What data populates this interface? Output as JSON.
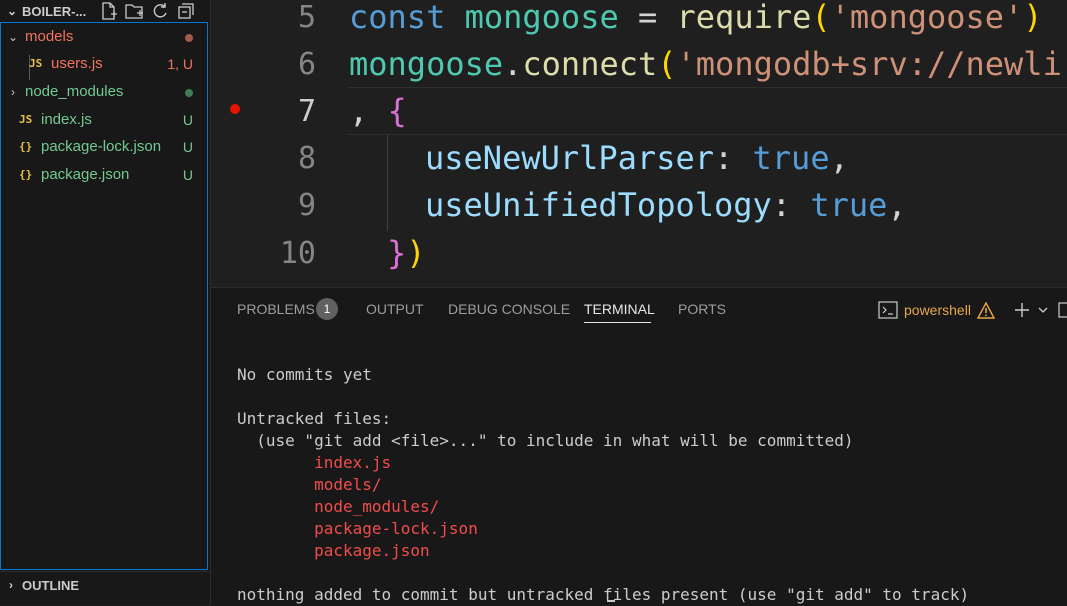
{
  "sidebar": {
    "title": "BOILER-...",
    "items": [
      {
        "label": "models",
        "status": "",
        "color": "#f2735f",
        "dot": "#a35a4c"
      },
      {
        "label": "users.js",
        "status": "1, U",
        "color": "#f2735f",
        "icon": "JS"
      },
      {
        "label": "node_modules",
        "status": "",
        "color": "#73c991",
        "dot": "#3e7d56"
      },
      {
        "label": "index.js",
        "status": "U",
        "color": "#73c991",
        "icon": "JS"
      },
      {
        "label": "package-lock.json",
        "status": "U",
        "color": "#73c991",
        "icon": "{}"
      },
      {
        "label": "package.json",
        "status": "U",
        "color": "#73c991",
        "icon": "{}"
      }
    ],
    "outline_label": "OUTLINE"
  },
  "editor": {
    "line_numbers": [
      "5",
      "6",
      "7",
      "8",
      "9",
      "10"
    ],
    "lines": [
      [
        [
          "const",
          "kw"
        ],
        [
          " ",
          "punc"
        ],
        [
          "mongoose",
          "var"
        ],
        [
          " = ",
          "punc"
        ],
        [
          "require",
          "fn"
        ],
        [
          "(",
          "br1"
        ],
        [
          "'mongoose'",
          "str"
        ],
        [
          ")",
          "br1"
        ]
      ],
      [
        [
          "mongoose",
          "var"
        ],
        [
          ".",
          "punc"
        ],
        [
          "connect",
          "fn"
        ],
        [
          "(",
          "br1"
        ],
        [
          "'mongodb+srv://newli",
          "str"
        ]
      ],
      [
        [
          ", ",
          "punc"
        ],
        [
          "{",
          "br2"
        ]
      ],
      [
        [
          "  useNewUrlParser",
          "prop"
        ],
        [
          ": ",
          "punc"
        ],
        [
          "true",
          "kw"
        ],
        [
          ",",
          "punc"
        ]
      ],
      [
        [
          "  useUnifiedTopology",
          "prop"
        ],
        [
          ": ",
          "punc"
        ],
        [
          "true",
          "kw"
        ],
        [
          ",",
          "punc"
        ]
      ],
      [
        [
          "}",
          "br2"
        ],
        [
          ")",
          "br1"
        ]
      ]
    ]
  },
  "panel": {
    "tabs": [
      "PROBLEMS",
      "OUTPUT",
      "DEBUG CONSOLE",
      "TERMINAL",
      "PORTS"
    ],
    "problems_count": "1",
    "active_tab": "TERMINAL",
    "shell_name": "powershell"
  },
  "terminal": {
    "lines": [
      {
        "text": "No commits yet",
        "color": "normal"
      },
      {
        "text": "",
        "color": "normal"
      },
      {
        "text": "Untracked files:",
        "color": "normal"
      },
      {
        "text": "  (use \"git add <file>...\" to include in what will be committed)",
        "color": "normal"
      },
      {
        "text": "        index.js",
        "color": "red"
      },
      {
        "text": "        models/",
        "color": "red"
      },
      {
        "text": "        node_modules/",
        "color": "red"
      },
      {
        "text": "        package-lock.json",
        "color": "red"
      },
      {
        "text": "        package.json",
        "color": "red"
      },
      {
        "text": "",
        "color": "normal"
      },
      {
        "text": "nothing added to commit but untracked files present (use \"git add\" to track)",
        "color": "normal"
      }
    ]
  }
}
